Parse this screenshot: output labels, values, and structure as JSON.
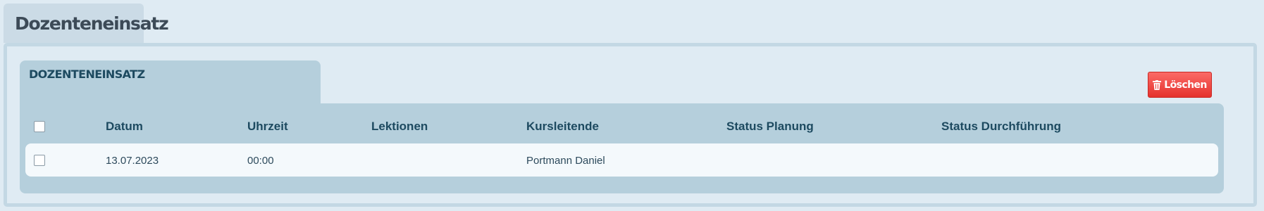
{
  "page": {
    "tab_title": "Dozenteneinsatz"
  },
  "section": {
    "title": "DOZENTENEINSATZ",
    "delete_label": "Löschen"
  },
  "table": {
    "columns": [
      "Datum",
      "Uhrzeit",
      "Lektionen",
      "Kursleitende",
      "Status Planung",
      "Status Durchführung"
    ],
    "rows": [
      {
        "selected": false,
        "datum": "13.07.2023",
        "uhrzeit": "00:00",
        "lektionen": "",
        "kursleitende": "Portmann Daniel",
        "status_planung": "",
        "status_durchfuehrung": ""
      }
    ]
  },
  "icons": {
    "delete": "trash-icon"
  },
  "colors": {
    "delete_button": "#e5322d",
    "panel": "#b5cfdc",
    "background": "#dfebf3"
  }
}
